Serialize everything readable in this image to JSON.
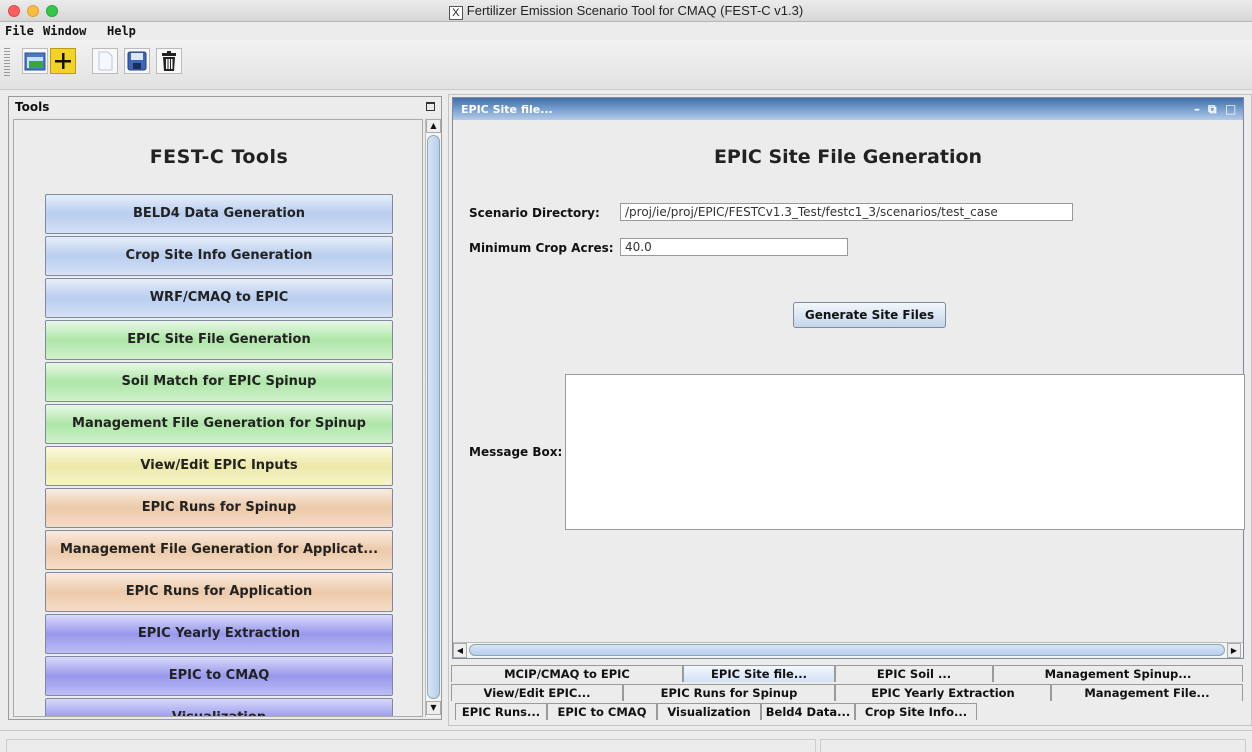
{
  "window": {
    "title": "Fertilizer Emission Scenario Tool for CMAQ (FEST-C v1.3)"
  },
  "menu": [
    {
      "label": "File"
    },
    {
      "label": "Window"
    },
    {
      "label": "Help"
    }
  ],
  "toolbar": [
    {
      "icon": "folder-open-icon"
    },
    {
      "icon": "add-icon"
    },
    {
      "icon": "document-icon"
    },
    {
      "icon": "save-icon"
    },
    {
      "icon": "trash-icon"
    }
  ],
  "tools_panel": {
    "header": "Tools",
    "title": "FEST-C Tools",
    "buttons": [
      {
        "label": "BELD4 Data Generation",
        "color": "blue"
      },
      {
        "label": "Crop Site Info Generation",
        "color": "blue"
      },
      {
        "label": "WRF/CMAQ to EPIC",
        "color": "blue"
      },
      {
        "label": "EPIC Site File Generation",
        "color": "green"
      },
      {
        "label": "Soil Match for EPIC Spinup",
        "color": "green"
      },
      {
        "label": "Management File Generation for Spinup",
        "color": "green"
      },
      {
        "label": "View/Edit EPIC Inputs",
        "color": "yellow"
      },
      {
        "label": "EPIC Runs for Spinup",
        "color": "orange"
      },
      {
        "label": "Management File Generation for Applicat...",
        "color": "orange"
      },
      {
        "label": "EPIC Runs for Application",
        "color": "orange"
      },
      {
        "label": "EPIC Yearly Extraction",
        "color": "purple"
      },
      {
        "label": "EPIC to CMAQ",
        "color": "purple"
      },
      {
        "label": "Visualization",
        "color": "purple"
      }
    ]
  },
  "site_window": {
    "title": "EPIC Site file...",
    "heading": "EPIC Site File Generation",
    "scenario_dir_label": "Scenario Directory:",
    "scenario_dir_value": "/proj/ie/proj/EPIC/FESTCv1.3_Test/festc1_3/scenarios/test_case",
    "min_crop_label": "Minimum Crop Acres:",
    "min_crop_value": "40.0",
    "generate_button": "Generate Site Files",
    "message_label": "Message Box:"
  },
  "tabs": {
    "row1": [
      "MCIP/CMAQ to EPIC",
      "EPIC Site file...",
      "EPIC Soil ...",
      "Management Spinup..."
    ],
    "row2": [
      "View/Edit EPIC...",
      "EPIC Runs for Spinup",
      "EPIC Yearly Extraction",
      "Management File..."
    ],
    "row3": [
      "EPIC Runs...",
      "EPIC to CMAQ",
      "Visualization",
      "Beld4 Data...",
      "Crop Site Info..."
    ],
    "selected": "EPIC Site file..."
  },
  "colors": {
    "blue": "#b9cdef",
    "green": "#aee6a8",
    "yellow": "#ede9a9",
    "orange": "#ecc9a9",
    "purple": "#9898ec"
  }
}
